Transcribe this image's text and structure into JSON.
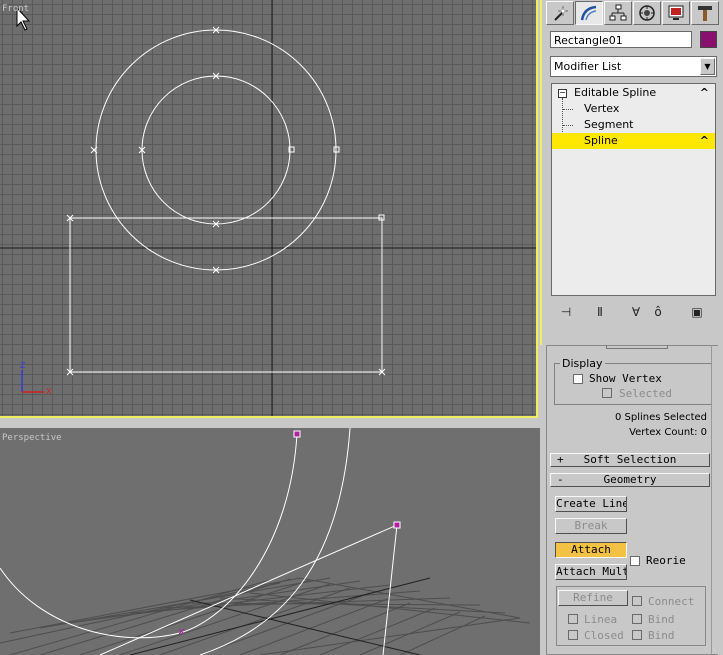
{
  "viewports": {
    "front_label": "Front",
    "perspective_label": "Perspective",
    "axis_z": "Z",
    "axis_x": "X"
  },
  "command_panel": {
    "tabs": [
      {
        "name": "create-tab",
        "icon": "create-icon"
      },
      {
        "name": "modify-tab",
        "icon": "modify-icon"
      },
      {
        "name": "hierarchy-tab",
        "icon": "hierarchy-icon"
      },
      {
        "name": "motion-tab",
        "icon": "motion-icon"
      },
      {
        "name": "display-tab",
        "icon": "display-icon"
      },
      {
        "name": "utilities-tab",
        "icon": "utilities-icon"
      }
    ],
    "object_name": "Rectangle01",
    "object_color": "#8a1070",
    "modifier_list": "Modifier List",
    "stack": {
      "root": "Editable Spline",
      "items": [
        "Vertex",
        "Segment",
        "Spline"
      ],
      "selected": "Spline"
    },
    "selection_rollout": {
      "display_group": "Display",
      "show_vertex": "Show Vertex",
      "selected": "Selected",
      "status_line1": "0 Splines Selected",
      "status_line2": "Vertex Count: 0"
    },
    "soft_selection": {
      "sign": "+",
      "title": "Soft Selection"
    },
    "geometry": {
      "sign": "-",
      "title": "Geometry",
      "create_line": "Create Line",
      "break": "Break",
      "attach": "Attach",
      "reorient": "Reorie",
      "attach_mult": "Attach Mult",
      "refine": "Refine",
      "connect": "Connect",
      "linear": "Linea",
      "bind1": "Bind",
      "closed": "Closed",
      "bind2": "Bind"
    }
  },
  "colors": {
    "active_viewport_border": "#f0ee5e",
    "selected_stack_item": "#ffe800",
    "attach_active": "#f3c143",
    "spline_color": "#ffffff"
  }
}
